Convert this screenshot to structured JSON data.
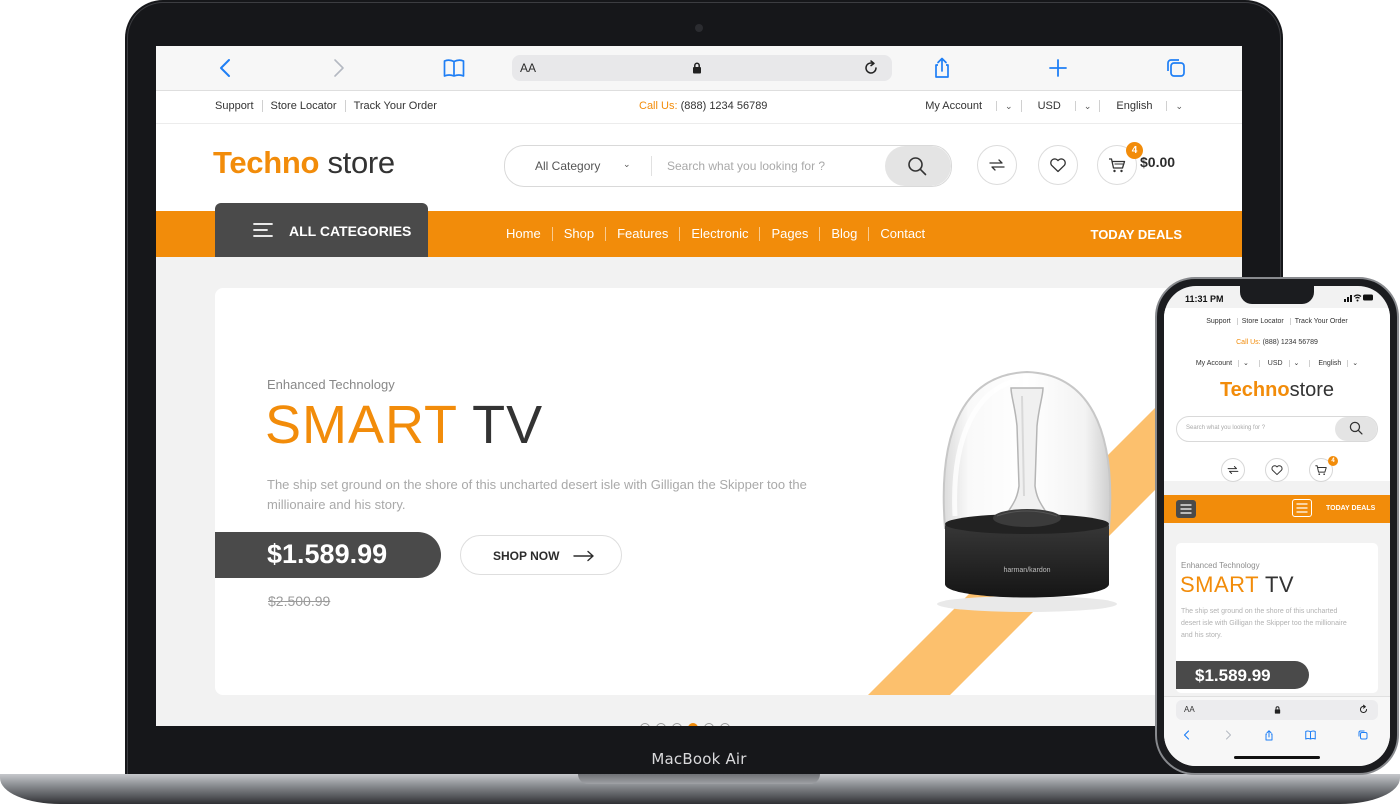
{
  "device_label": "MacBook Air",
  "browser": {
    "address_aa": "AA"
  },
  "topbar": {
    "links": [
      "Support",
      "Store Locator",
      "Track Your Order"
    ],
    "call_label": "Call Us:",
    "call_number": "(888) 1234 56789",
    "account": "My Account",
    "currency": "USD",
    "language": "English"
  },
  "header": {
    "logo_bold": "Techno",
    "logo_regular": "store",
    "search_category": "All Category",
    "search_placeholder": "Search what you looking for ?",
    "cart_count": "4",
    "cart_total": "$0.00"
  },
  "nav": {
    "all_categories": "ALL CATEGORIES",
    "items": [
      "Home",
      "Shop",
      "Features",
      "Electronic",
      "Pages",
      "Blog",
      "Contact"
    ],
    "deals": "TODAY DEALS"
  },
  "hero": {
    "kicker": "Enhanced Technology",
    "headline_accent": "SMART",
    "headline_dark": "TV",
    "description": "The ship set ground on the shore of this uncharted desert isle with Gilligan the Skipper too the millionaire and his story.",
    "price": "$1.589.99",
    "old_price": "$2.500.99",
    "cta": "SHOP NOW",
    "product_brand": "harman/kardon",
    "slides": 6,
    "active_slide": 4
  },
  "phone": {
    "time": "11:31 PM",
    "address_aa": "AA",
    "description": "The ship set ground on the shore of this uncharted desert isle with Gilligan the Skipper too the millionaire and his story."
  },
  "colors": {
    "accent": "#f28c0a",
    "dark": "#4a4a4a",
    "stripe": "#fcc06d",
    "ios_blue": "#1f7ff5"
  },
  "icons": [
    "back-icon",
    "forward-icon",
    "bookmarks-icon",
    "lock-icon",
    "reload-icon",
    "share-icon",
    "plus-icon",
    "tabs-icon",
    "hamburger-icon",
    "search-icon",
    "compare-icon",
    "heart-icon",
    "cart-icon",
    "arrow-right-icon",
    "signal-icon",
    "wifi-icon",
    "battery-icon"
  ]
}
